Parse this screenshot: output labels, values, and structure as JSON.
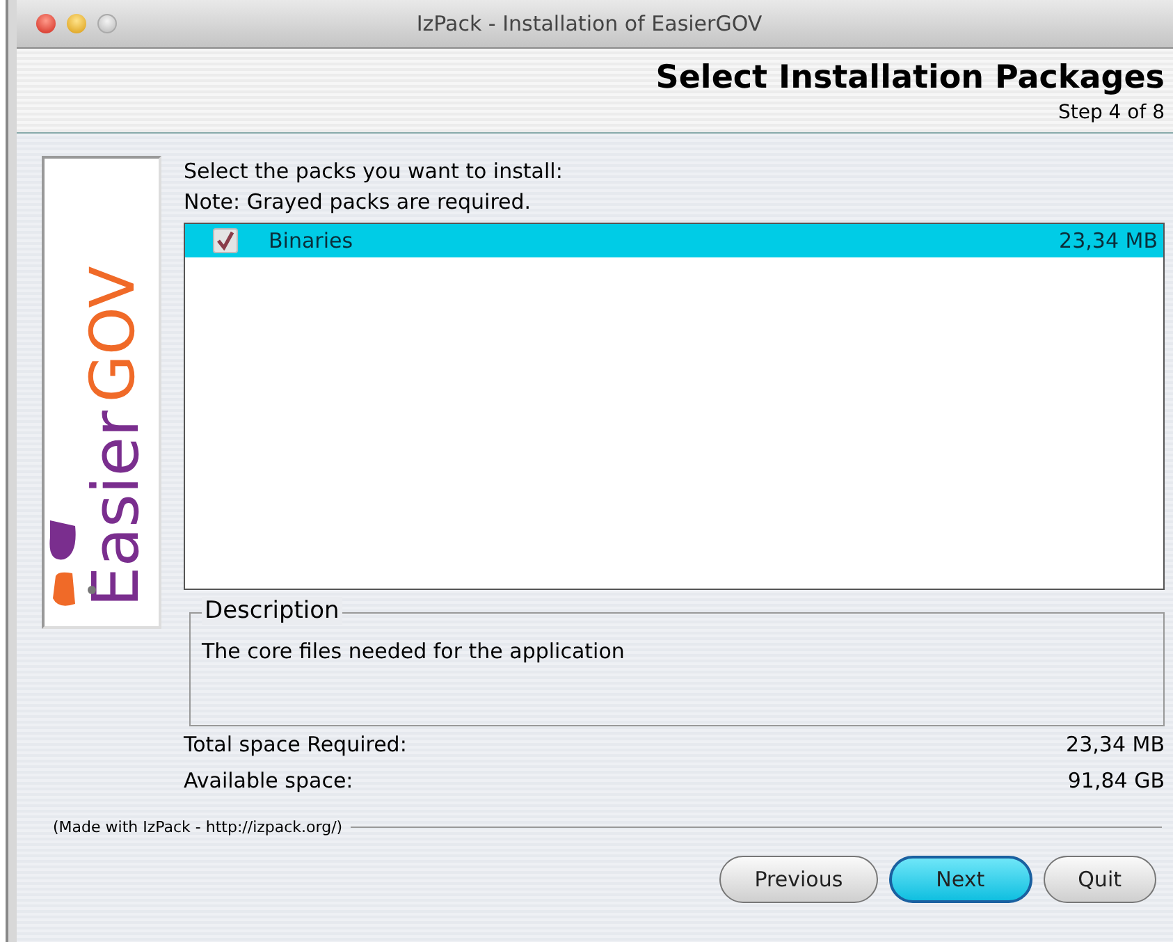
{
  "window": {
    "title": "IzPack - Installation of EasierGOV"
  },
  "header": {
    "title": "Select Installation Packages",
    "step": "Step 4 of 8"
  },
  "logo": {
    "word_1": "Easier",
    "word_2": "GOV"
  },
  "intro": [
    "Select the packs you want to install:",
    "Note: Grayed packs are required."
  ],
  "packs": [
    {
      "name": "Binaries",
      "size": "23,34 MB",
      "checked": true,
      "disabled": true,
      "selected": true
    }
  ],
  "description": {
    "legend": "Description",
    "text": "The core files needed for the application"
  },
  "space": [
    {
      "label": "Total space Required:",
      "value": "23,34 MB"
    },
    {
      "label": "Available space:",
      "value": "91,84 GB"
    }
  ],
  "credit": "(Made with IzPack - http://izpack.org/)",
  "buttons": [
    {
      "label": "Previous",
      "default": false
    },
    {
      "label": "Next",
      "default": true
    },
    {
      "label": "Quit",
      "default": false
    }
  ]
}
